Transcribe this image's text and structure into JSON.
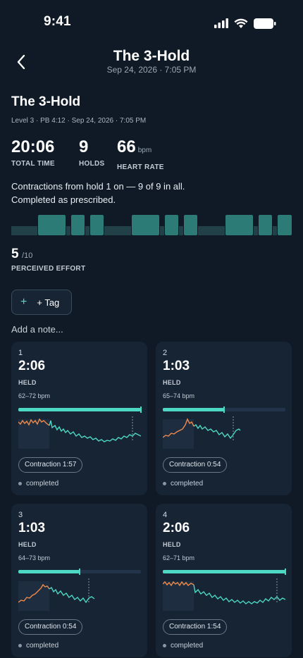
{
  "status_bar": {
    "time": "9:41"
  },
  "nav": {
    "title": "The 3-Hold",
    "subtitle": "Sep 24, 2026 · 7:05 PM"
  },
  "session": {
    "title": "The 3-Hold",
    "meta": "Level 3 · PB 4:12 · Sep 24, 2026 · 7:05 PM",
    "stats": [
      {
        "value": "20:06",
        "unit": "",
        "label": "TOTAL TIME"
      },
      {
        "value": "9",
        "unit": "",
        "label": "HOLDS"
      },
      {
        "value": "66",
        "unit": "bpm",
        "label": "HEART RATE"
      }
    ],
    "summary_line1": "Contractions from hold 1 on — 9 of 9 in all.",
    "summary_line2": "Completed as prescribed.",
    "effort": {
      "value": "5",
      "max": "/10",
      "label": "PERCEIVED EFFORT"
    },
    "tag_label": "+ Tag",
    "note_placeholder": "Add a note..."
  },
  "holds": [
    {
      "number": "1",
      "duration": "2:06",
      "held_label": "HELD",
      "bpm_range": "62–72 bpm",
      "progress": 1.0,
      "contraction": "Contraction 1:57",
      "status": "completed"
    },
    {
      "number": "2",
      "duration": "1:03",
      "held_label": "HELD",
      "bpm_range": "65–74 bpm",
      "progress": 0.5,
      "contraction": "Contraction 0:54",
      "status": "completed"
    },
    {
      "number": "3",
      "duration": "1:03",
      "held_label": "HELD",
      "bpm_range": "64–73 bpm",
      "progress": 0.5,
      "contraction": "Contraction 0:54",
      "status": "completed"
    },
    {
      "number": "4",
      "duration": "2:06",
      "held_label": "HELD",
      "bpm_range": "62–71 bpm",
      "progress": 1.0,
      "contraction": "Contraction 1:54",
      "status": "completed"
    }
  ],
  "colors": {
    "background": "#0f1a26",
    "accent": "#4dd8c4",
    "pre_contraction": "#f08a4b",
    "hold_segment": "#2c7b76",
    "rest_segment": "#214048"
  }
}
